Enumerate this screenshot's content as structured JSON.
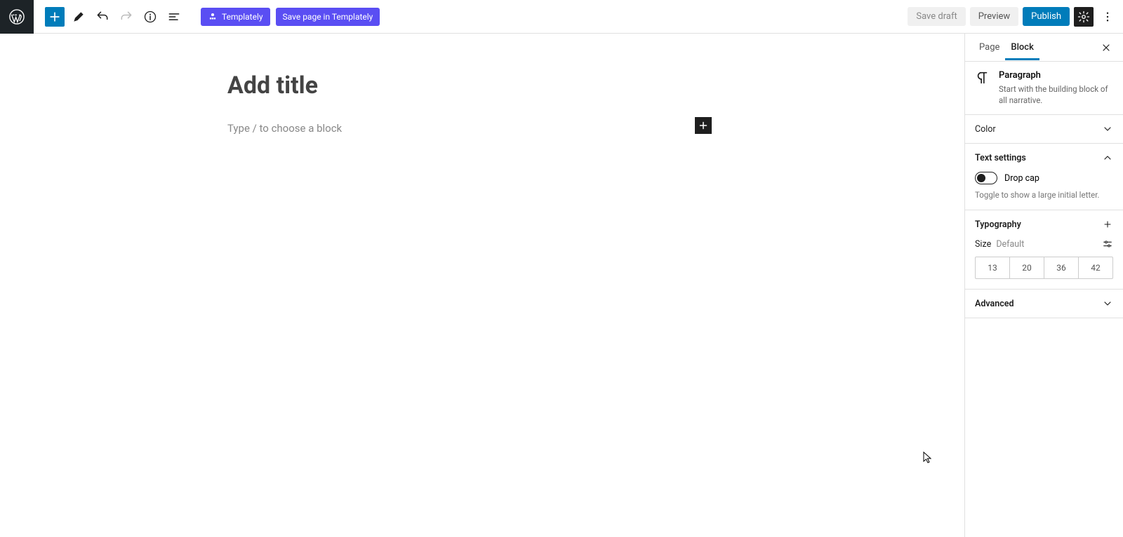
{
  "toolbar": {
    "templately_label": "Templately",
    "save_templately_label": "Save page in Templately",
    "save_draft_label": "Save draft",
    "preview_label": "Preview",
    "publish_label": "Publish"
  },
  "canvas": {
    "title_placeholder": "Add title",
    "block_placeholder": "Type / to choose a block"
  },
  "sidebar": {
    "tabs": {
      "page": "Page",
      "block": "Block"
    },
    "block_info": {
      "title": "Paragraph",
      "description": "Start with the building block of all narrative."
    },
    "panels": {
      "color": {
        "title": "Color"
      },
      "text_settings": {
        "title": "Text settings",
        "drop_cap_label": "Drop cap",
        "drop_cap_help": "Toggle to show a large initial letter."
      },
      "typography": {
        "title": "Typography",
        "size_label": "Size",
        "size_default": "Default",
        "sizes": [
          "13",
          "20",
          "36",
          "42"
        ]
      },
      "advanced": {
        "title": "Advanced"
      }
    }
  }
}
